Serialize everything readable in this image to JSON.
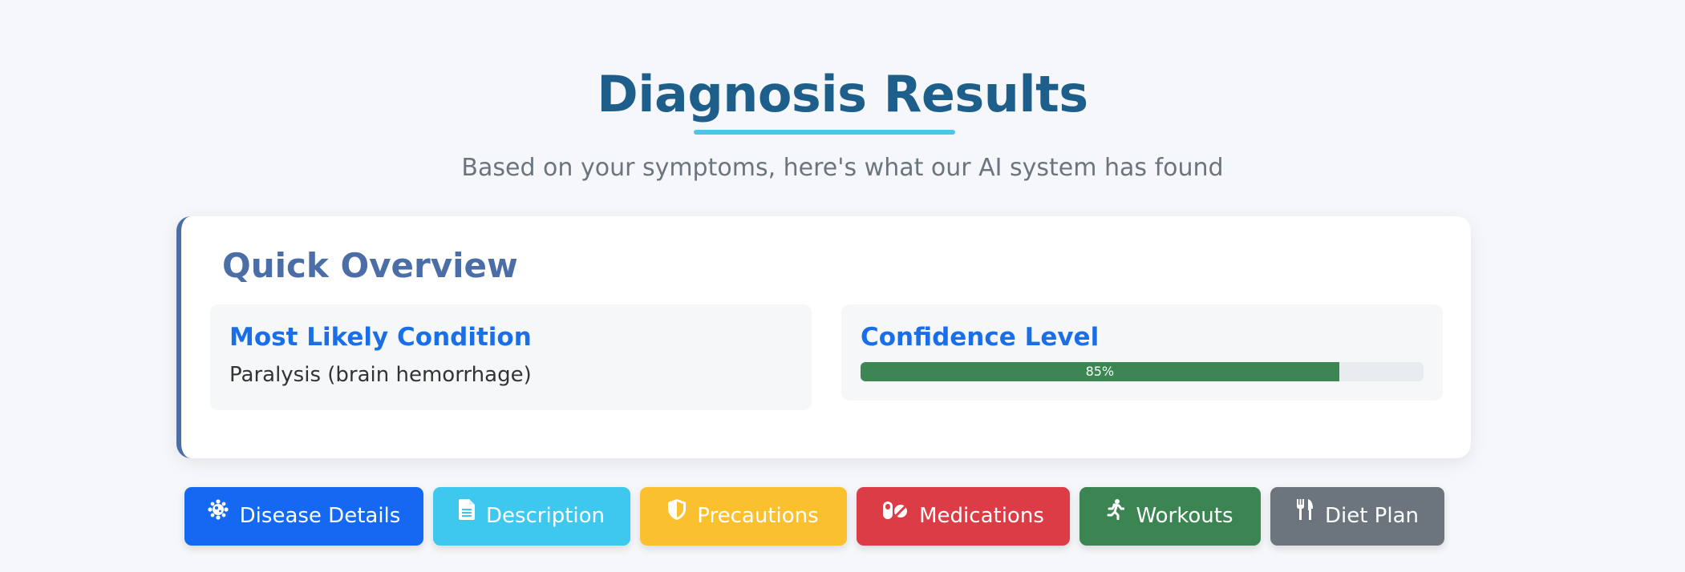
{
  "header": {
    "title": "Diagnosis Results",
    "subtitle": "Based on your symptoms, here's what our AI system has found"
  },
  "overview": {
    "title": "Quick Overview",
    "condition": {
      "heading": "Most Likely Condition",
      "value": "Paralysis (brain hemorrhage)"
    },
    "confidence": {
      "heading": "Confidence Level",
      "value": 85,
      "label": "85%"
    }
  },
  "colors": {
    "title": "#1d5f8a",
    "accent_underline": "#4dc4ea",
    "overview_border": "#4a6ea5",
    "heading_blue": "#1a6fe8",
    "progress_fill": "#3b8653"
  },
  "tabs": [
    {
      "label": "Disease Details",
      "icon": "virus-icon",
      "color": "#1468f2"
    },
    {
      "label": "Description",
      "icon": "document-icon",
      "color": "#3ec8ee"
    },
    {
      "label": "Precautions",
      "icon": "shield-icon",
      "color": "#fbc02d"
    },
    {
      "label": "Medications",
      "icon": "pills-icon",
      "color": "#dc3c46"
    },
    {
      "label": "Workouts",
      "icon": "running-person-icon",
      "color": "#3a8552"
    },
    {
      "label": "Diet Plan",
      "icon": "utensils-icon",
      "color": "#6c757d"
    }
  ]
}
